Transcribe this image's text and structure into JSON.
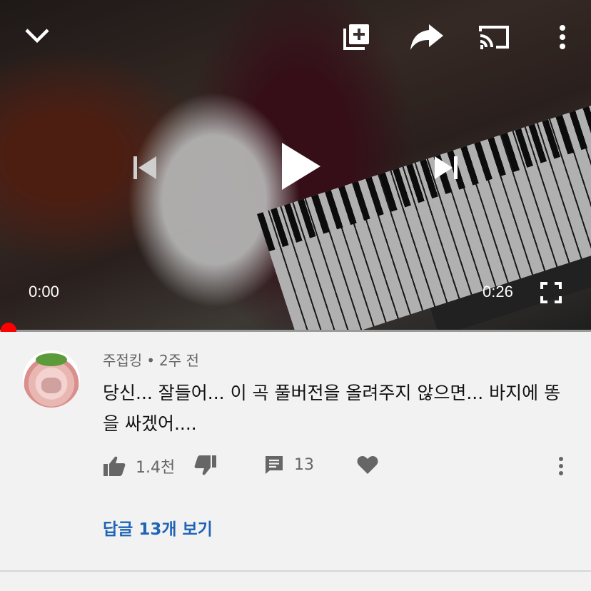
{
  "player": {
    "current_time": "0:00",
    "duration": "0:26",
    "progress": 0.0,
    "icons": {
      "collapse": "chevron-down-icon",
      "add_to_playlist": "add-to-playlist-icon",
      "share": "share-icon",
      "cast": "cast-icon",
      "more": "more-vert-icon",
      "previous": "skip-previous-icon",
      "play": "play-icon",
      "next": "skip-next-icon",
      "fullscreen": "fullscreen-icon"
    },
    "progress_color": "#ff0000"
  },
  "comment": {
    "author": "주접킹",
    "separator": "•",
    "time_ago": "2주 전",
    "text": "당신... 잘들어... 이 곡 풀버전을 올려주지 않으면... 바지에 똥을 싸겠어....",
    "likes": "1.4천",
    "reply_count": "13",
    "view_replies_label": "답글 13개 보기",
    "link_color": "#1f64b5"
  }
}
